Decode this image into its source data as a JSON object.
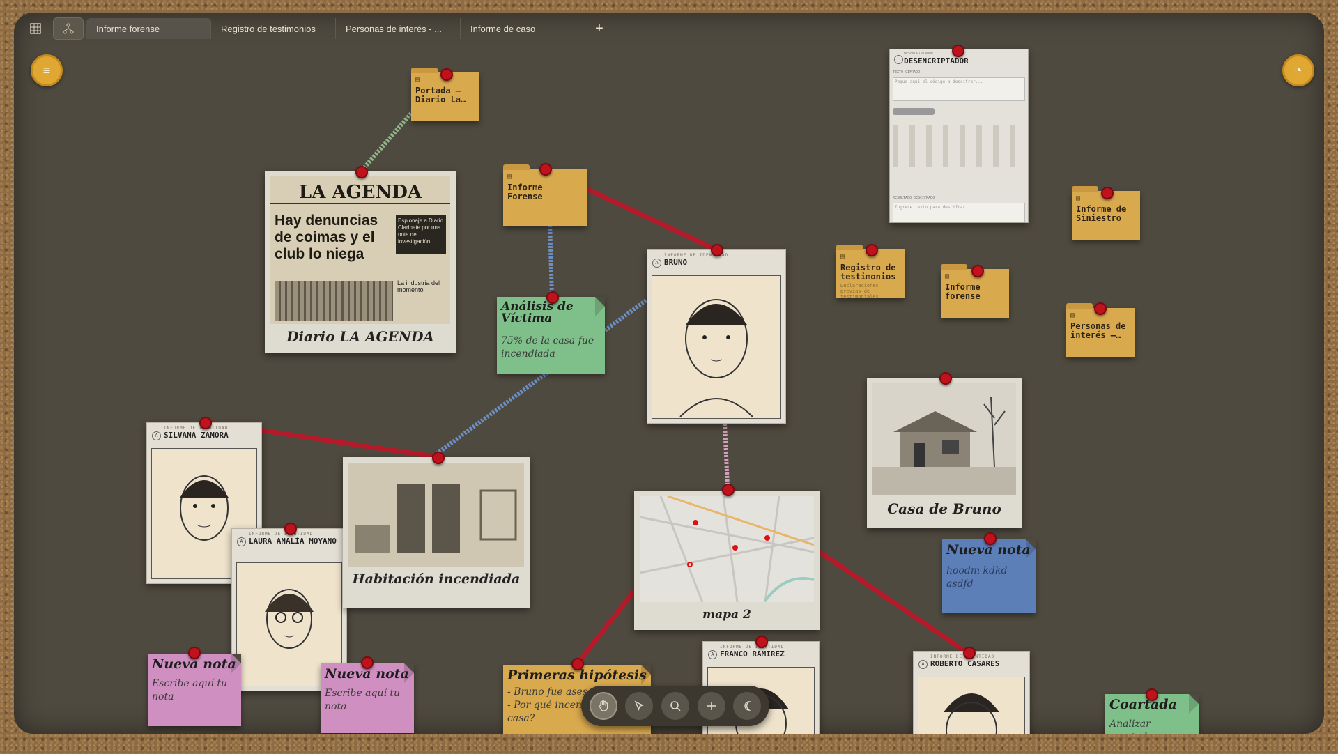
{
  "tabs": {
    "grid_icon": "grid-icon",
    "graph_icon": "graph-icon",
    "items": [
      "Informe forense",
      "Registro de testimonios",
      "Personas de interés - ...",
      "Informe de caso"
    ],
    "add": "+"
  },
  "fabs": {
    "menu": "≡",
    "history": "◔"
  },
  "folders": {
    "portada": "Portada – Diario La…",
    "informe_forense_top": "Informe Forense",
    "registro": "Registro de testimonios",
    "registro_sub": "Declaraciones previas de testimoniales",
    "informe_forense_right": "Informe forense",
    "siniestro": "Informe de Siniestro",
    "personas": "Personas de interés –…"
  },
  "newspaper": {
    "masthead": "LA AGENDA",
    "headline": "Hay denuncias de coimas y el club lo niega",
    "sidebar": "Espionaje a Diario Clarinete por una nota de investigación",
    "sidebar2": "La industria del momento",
    "caption": "Diario LA AGENDA"
  },
  "photos": {
    "habitacion": "Habitación incendiada",
    "mapa": "mapa 2",
    "casa": "Casa de Bruno"
  },
  "id_cards": {
    "header": "INFORME DE IDENTIDAD",
    "bruno": "BRUNO",
    "silvana": "SILVANA ZAMORA",
    "laura": "LAURA ANALÍA MOYANO",
    "franco": "FRANCO RAMIREZ",
    "roberto": "ROBERTO CASARES"
  },
  "notes": {
    "analisis_title": "Análisis de Víctima",
    "analisis_body": "75% de la casa fue incendiada",
    "nueva_blue_title": "Nueva nota",
    "nueva_blue_body": "hoodm kdkd asdfd",
    "nueva_pink1_title": "Nueva nota",
    "nueva_pink1_body": "Escribe aquí tu nota",
    "nueva_pink2_title": "Nueva nota",
    "nueva_pink2_body": "Escribe aquí tu nota",
    "hipotesis_title": "Primeras hipótesis",
    "hipotesis_body": "- Bruno fue ases\n- Por qué incend\ncasa?",
    "coartada_title": "Coartada",
    "coartada_body": "Analizar coartada"
  },
  "descriptor": {
    "sub": "DESENCRIPTADOR",
    "title": "DESENCRIPTADOR",
    "input_label": "TEXTO CIFRADO",
    "input_placeholder": "Pegue aquí el código a descifrar...",
    "result_label": "RESULTADO DESCIFRADO",
    "result_placeholder": "Ingrese texto para descifrar..."
  },
  "toolbar": {
    "hand": "hand-icon",
    "pointer": "pointer-icon",
    "search": "search-icon",
    "add": "plus-icon",
    "moon": "moon-icon"
  },
  "colors": {
    "board": "#4f4a3f",
    "red_string": "#b51a2a",
    "blue_string": "#6d8fc4",
    "green_string": "#8fb88a",
    "pink_string": "#d6a0c0",
    "pin": "#c0121c",
    "folder": "#d9a94e",
    "accent": "#e0a832"
  }
}
